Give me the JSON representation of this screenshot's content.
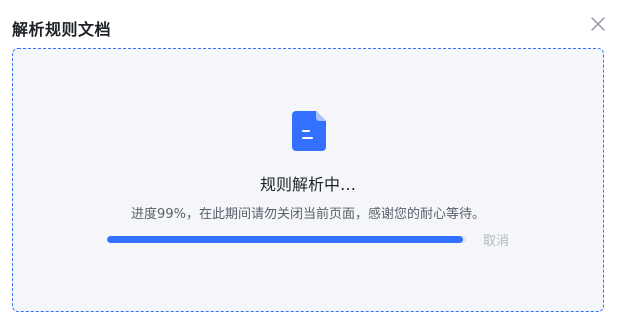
{
  "dialog": {
    "title": "解析规则文档",
    "close_icon": "close-icon"
  },
  "upload": {
    "file_icon": "document-icon",
    "status_title": "规则解析中…",
    "status_desc": "进度99%，在此期间请勿关闭当前页面，感谢您的耐心等待。",
    "progress_percent": 99,
    "cancel_label": "取消"
  },
  "colors": {
    "accent": "#3370ff",
    "track": "#e4e7ee",
    "dropzone_bg": "#f5f6fa",
    "cancel_text": "#b3b8c2"
  }
}
